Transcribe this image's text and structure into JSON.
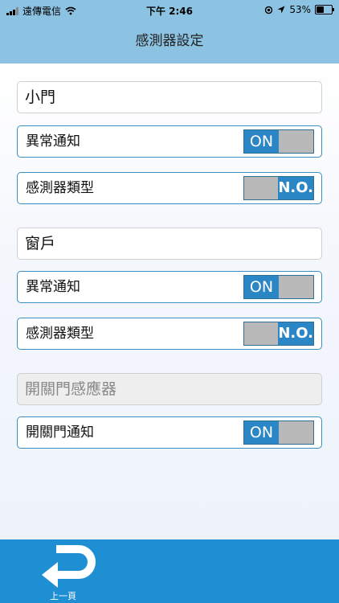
{
  "status_bar": {
    "carrier": "遠傳電信",
    "time": "下午 2:46",
    "battery": "53%",
    "battery_level": 0.53
  },
  "header": {
    "title": "感測器設定"
  },
  "sensors": [
    {
      "name": "小門",
      "rows": [
        {
          "label": "異常通知",
          "toggle": "ON"
        },
        {
          "label": "感測器類型",
          "toggle": "N.O."
        }
      ]
    },
    {
      "name": "窗戶",
      "rows": [
        {
          "label": "異常通知",
          "toggle": "ON"
        },
        {
          "label": "感測器類型",
          "toggle": "N.O."
        }
      ]
    },
    {
      "name": "開關門感應器",
      "rows": [
        {
          "label": "開關門通知",
          "toggle": "ON"
        }
      ]
    }
  ],
  "bottom_bar": {
    "back_label": "上一頁"
  },
  "colors": {
    "header": "#8cc3e3",
    "accent": "#2b86c5",
    "bottom_bar": "#1e8fd3",
    "toggle_off": "#b9b9b9"
  }
}
